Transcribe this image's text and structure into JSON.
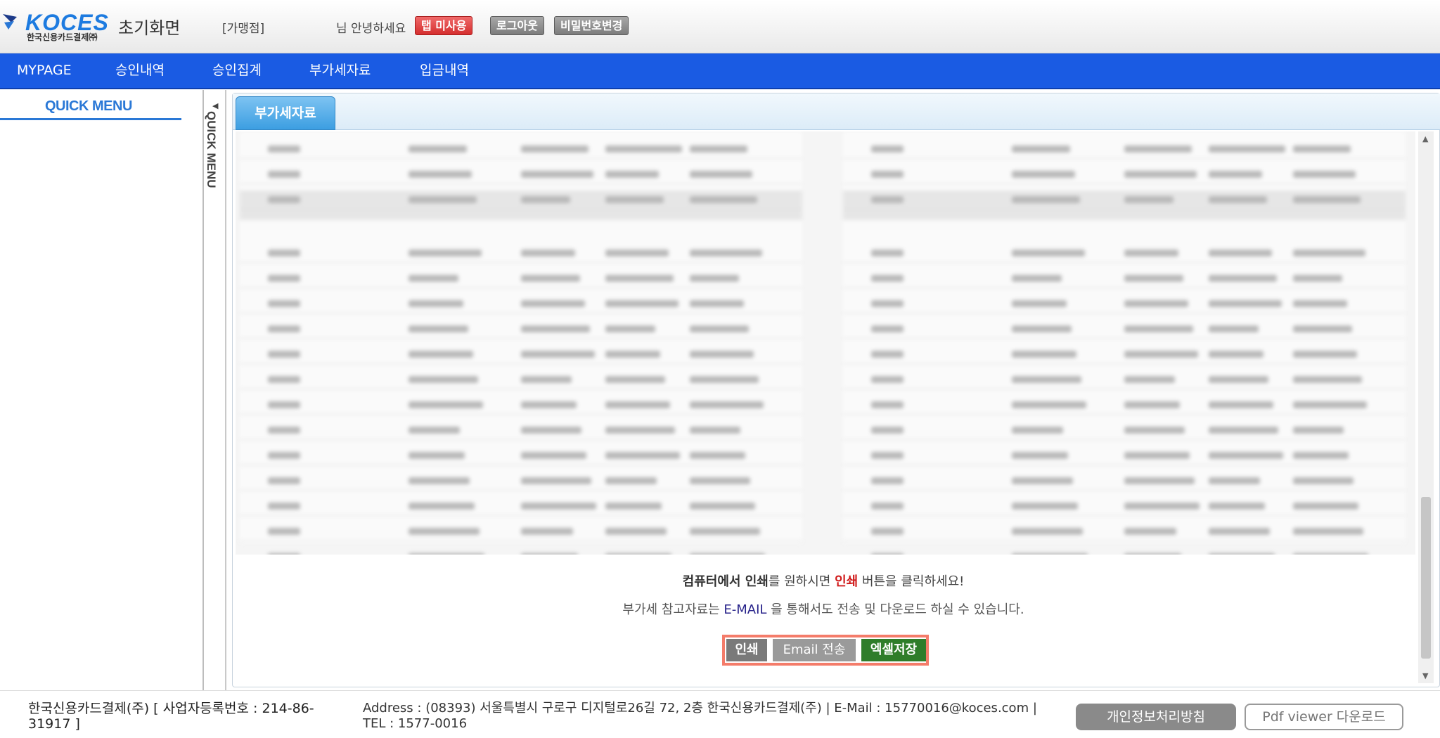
{
  "header": {
    "logo_text": "KOCES",
    "logo_subtext": "한국신용카드결제㈜",
    "home_title": "초기화면",
    "store_name": "[가맹점]",
    "greeting": "님 안녕하세요",
    "tab_unused_button": "탭 미사용",
    "logout_button": "로그아웃",
    "change_password_button": "비밀번호변경"
  },
  "nav": {
    "items": [
      "MYPAGE",
      "승인내역",
      "승인집계",
      "부가세자료",
      "입금내역"
    ]
  },
  "sidebar": {
    "quick_menu_title": "QUICK MENU",
    "quick_menu_vertical": "QUICK MENU"
  },
  "content": {
    "active_tab": "부가세자료",
    "message1": {
      "part1": "컴퓨터에서 ",
      "part2": "인쇄",
      "part3": "를 원하시면 ",
      "part4": "인쇄",
      "part5": " 버튼을 클릭하세요!"
    },
    "message2": {
      "part1": "부가세 참고자료는 ",
      "part2": "E-MAIL",
      "part3": " 을 통해서도 전송 및 다운로드 하실 수 있습니다."
    },
    "buttons": {
      "print": "인쇄",
      "email": "Email 전송",
      "excel": "엑셀저장"
    }
  },
  "footer": {
    "company": "한국신용카드결제(주) [ 사업자등록번호 : 214-86-31917 ]",
    "address": "Address : (08393) 서울특별시 구로구 디지털로26길 72, 2층 한국신용카드결제(주) | E-Mail : 15770016@koces.com | TEL : 1577-0016",
    "privacy_button": "개인정보처리방침",
    "pdf_button": "Pdf viewer 다운로드"
  },
  "colors": {
    "nav_bg": "#1a5be3",
    "tab_active": "#3c9ee1",
    "print_accent": "#d01a1a",
    "excel_green": "#2f7d2a",
    "highlight_border": "#f47c6a"
  }
}
